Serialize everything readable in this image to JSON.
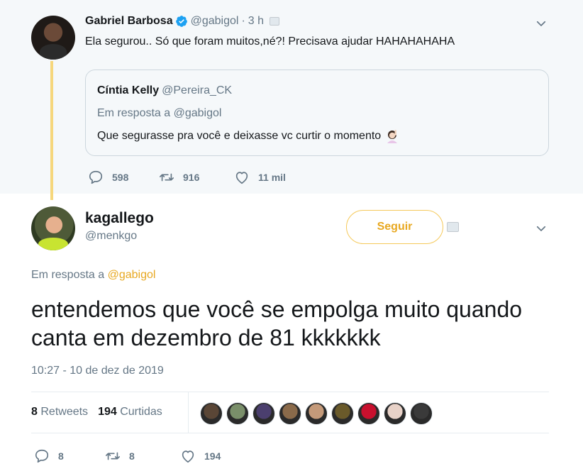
{
  "parent_tweet": {
    "author_name": "Gabriel Barbosa",
    "handle": "@gabigol",
    "separator": "·",
    "time": "3 h",
    "text": "Ela segurou.. Só que foram muitos,né?! Precisava ajudar HAHAHAHAHA",
    "quoted": {
      "author_name": "Cíntia Kelly",
      "handle": "@Pereira_CK",
      "reply_to": "Em resposta a @gabigol",
      "text": "Que segurasse pra você e deixasse vc curtir o momento"
    },
    "actions": {
      "replies": "598",
      "retweets": "916",
      "likes": "11 mil"
    }
  },
  "main_tweet": {
    "author_name": "kagallego",
    "handle": "@menkgo",
    "follow_label": "Seguir",
    "reply_to_prefix": "Em resposta a",
    "reply_to_mention": "@gabigol",
    "text": "entendemos que você se empolga muito quando canta em dezembro de 81 kkkkkkk",
    "timestamp": "10:27 - 10 de dez de 2019",
    "stats": {
      "retweets_count": "8",
      "retweets_label": "Retweets",
      "likes_count": "194",
      "likes_label": "Curtidas"
    },
    "likers": [
      "#5a4636",
      "#7a8f6a",
      "#4b3f6e",
      "#8a6a4a",
      "#c49a7a",
      "#6a5a2a",
      "#c8102e",
      "#e8d2c8",
      "#3a3a3a"
    ],
    "actions": {
      "replies": "8",
      "retweets": "8",
      "likes": "194"
    }
  },
  "colors": {
    "accent": "#e8a820",
    "verified": "#1da1f2",
    "secondary_text": "#657786",
    "parent_background": "#f5f8fa"
  },
  "icons": [
    "verified-icon",
    "chevron-down-icon",
    "reply-icon",
    "retweet-icon",
    "like-icon",
    "woman-raising-hand-emoji"
  ]
}
